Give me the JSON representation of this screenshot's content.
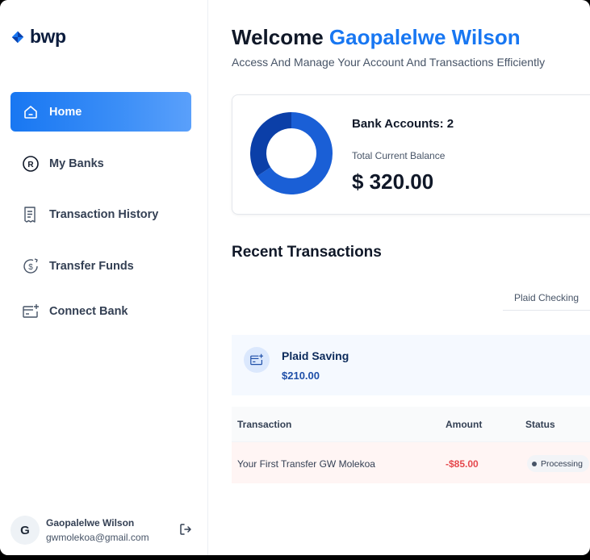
{
  "brand": {
    "name": "bwp",
    "accent": "#1877f2"
  },
  "sidebar": {
    "items": [
      {
        "label": "Home",
        "icon": "home-icon",
        "active": true
      },
      {
        "label": "My Banks",
        "icon": "bank-icon",
        "active": false
      },
      {
        "label": "Transaction History",
        "icon": "receipt-icon",
        "active": false
      },
      {
        "label": "Transfer Funds",
        "icon": "money-transfer-icon",
        "active": false
      },
      {
        "label": "Connect Bank",
        "icon": "connect-bank-icon",
        "active": false
      }
    ],
    "user": {
      "initial": "G",
      "name": "Gaopalelwe Wilson",
      "email": "gwmolekoa@gmail.com"
    }
  },
  "header": {
    "greeting": "Welcome",
    "user_name": "Gaopalelwe Wilson",
    "subtitle": "Access And Manage Your Account And Transactions Efficiently"
  },
  "balance": {
    "bank_accounts_label": "Bank Accounts: 2",
    "total_label": "Total Current Balance",
    "total_amount": "$ 320.00",
    "donut": [
      {
        "value": 210,
        "color": "#1a5fd6"
      },
      {
        "value": 110,
        "color": "#0b3fa8"
      }
    ]
  },
  "recent": {
    "title": "Recent Transactions",
    "tab": "Plaid Checking",
    "account": {
      "name": "Plaid Saving",
      "amount": "$210.00"
    },
    "columns": [
      "Transaction",
      "Amount",
      "Status"
    ],
    "rows": [
      {
        "name": "Your First Transfer GW Molekoa",
        "amount": "-$85.00",
        "status": "Processing"
      }
    ]
  }
}
